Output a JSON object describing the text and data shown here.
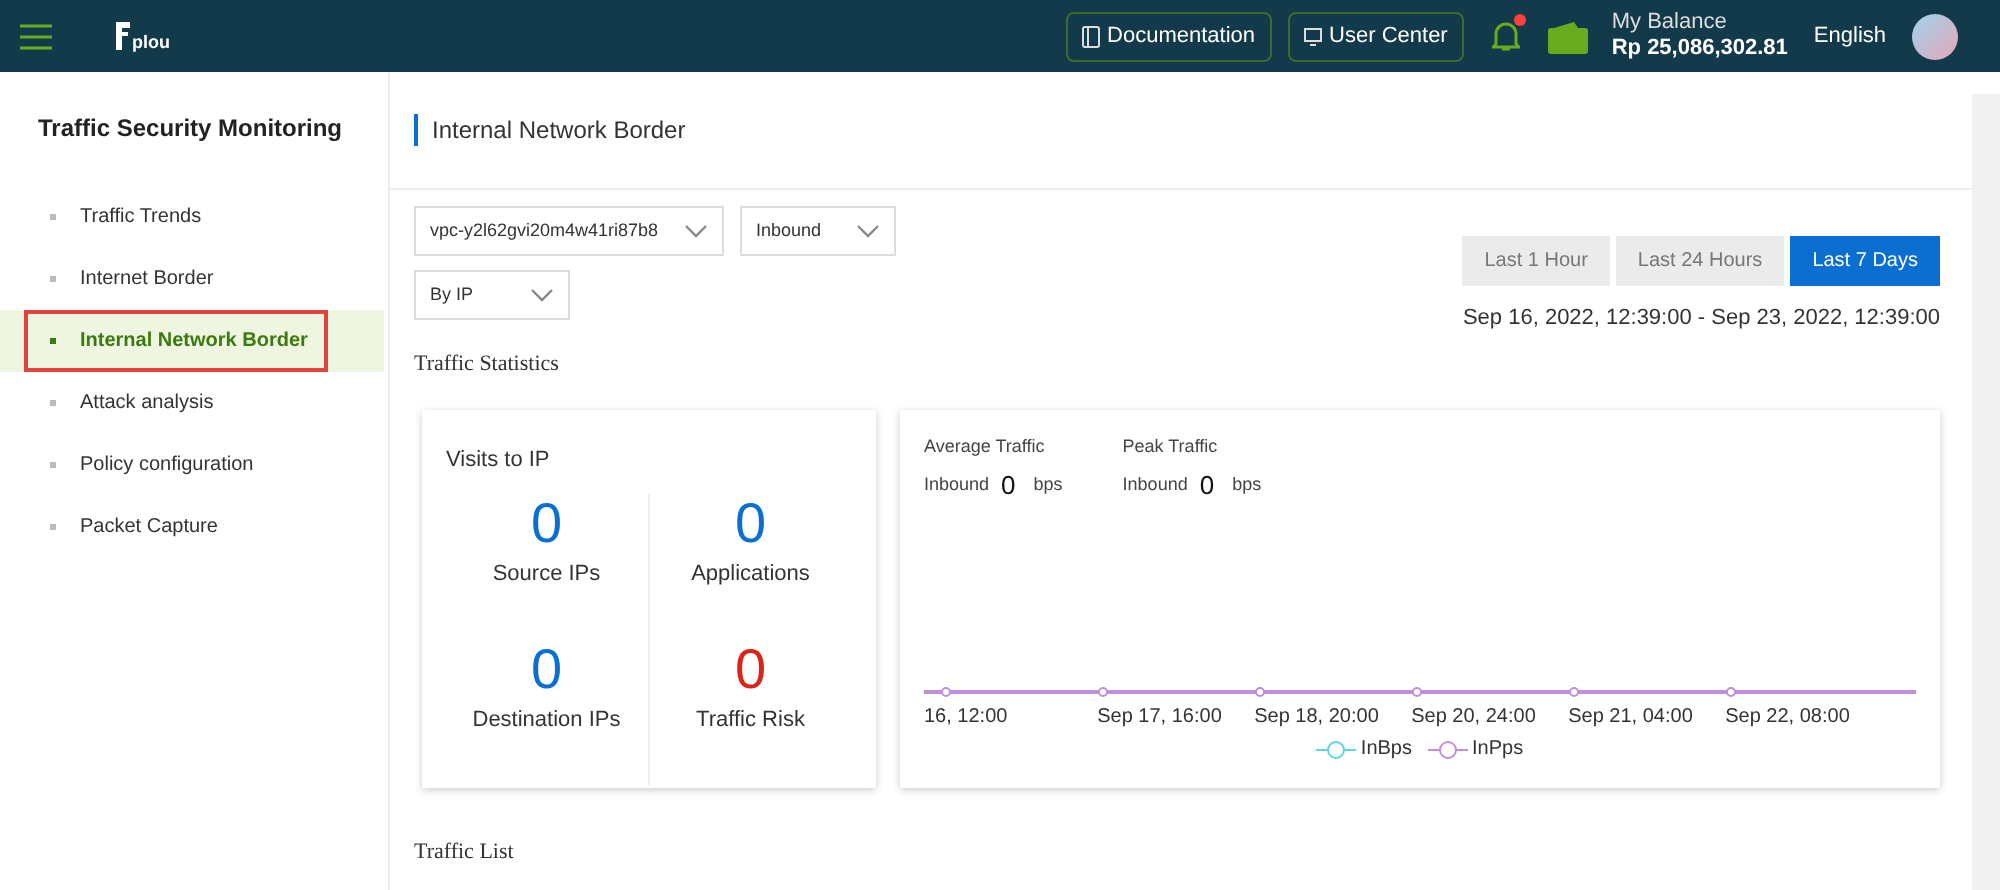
{
  "header": {
    "logo": "plou",
    "buttons": [
      {
        "kind": "doc",
        "label": "Documentation"
      },
      {
        "kind": "user",
        "label": "User Center"
      }
    ],
    "notification": {
      "unread": true
    },
    "balance": {
      "label": "My Balance",
      "value": "Rp 25,086,302.81"
    },
    "language": "English"
  },
  "sidebar": {
    "title": "Traffic Security Monitoring",
    "items": [
      {
        "label": "Traffic Trends",
        "selected": false
      },
      {
        "label": "Internet Border",
        "selected": false
      },
      {
        "label": "Internal Network Border",
        "selected": true
      },
      {
        "label": "Attack analysis",
        "selected": false
      },
      {
        "label": "Policy configuration",
        "selected": false
      },
      {
        "label": "Packet Capture",
        "selected": false
      }
    ]
  },
  "page_title": "Internal Network Border",
  "filters": [
    {
      "value": "vpc-y2l62gvi20m4w41ri87b8"
    },
    {
      "value": "Inbound"
    },
    {
      "value": "By IP"
    }
  ],
  "time_ranges": [
    {
      "label": "Last 1 Hour",
      "selected": false
    },
    {
      "label": "Last 24 Hours",
      "selected": false
    },
    {
      "label": "Last 7 Days",
      "selected": true
    }
  ],
  "date_range": "Sep 16, 2022, 12:39:00 - Sep 23, 2022, 12:39:00",
  "section_title": "Traffic Statistics",
  "visits": {
    "title": "Visits to IP",
    "stats": [
      {
        "value": "0",
        "label": "Source IPs",
        "color": "#0b6fd1"
      },
      {
        "value": "0",
        "label": "Applications",
        "color": "#0b6fd1"
      },
      {
        "value": "0",
        "label": "Destination IPs",
        "color": "#0b6fd1"
      },
      {
        "value": "0",
        "label": "Traffic Risk",
        "color": "#d9261c"
      }
    ]
  },
  "traffic": {
    "metrics": [
      {
        "title": "Average Traffic",
        "direction": "Inbound",
        "value": "0",
        "unit": "bps"
      },
      {
        "title": "Peak Traffic",
        "direction": "Inbound",
        "value": "0",
        "unit": "bps"
      }
    ],
    "x_labels": [
      "16, 12:00",
      "Sep 17, 16:00",
      "Sep 18, 20:00",
      "Sep 20, 24:00",
      "Sep 21, 04:00",
      "Sep 22, 08:00"
    ],
    "legend": [
      {
        "name": "InBps",
        "color": "#5fd3e8"
      },
      {
        "name": "InPps",
        "color": "#c08fdc"
      }
    ]
  },
  "list_title": "Traffic List"
}
